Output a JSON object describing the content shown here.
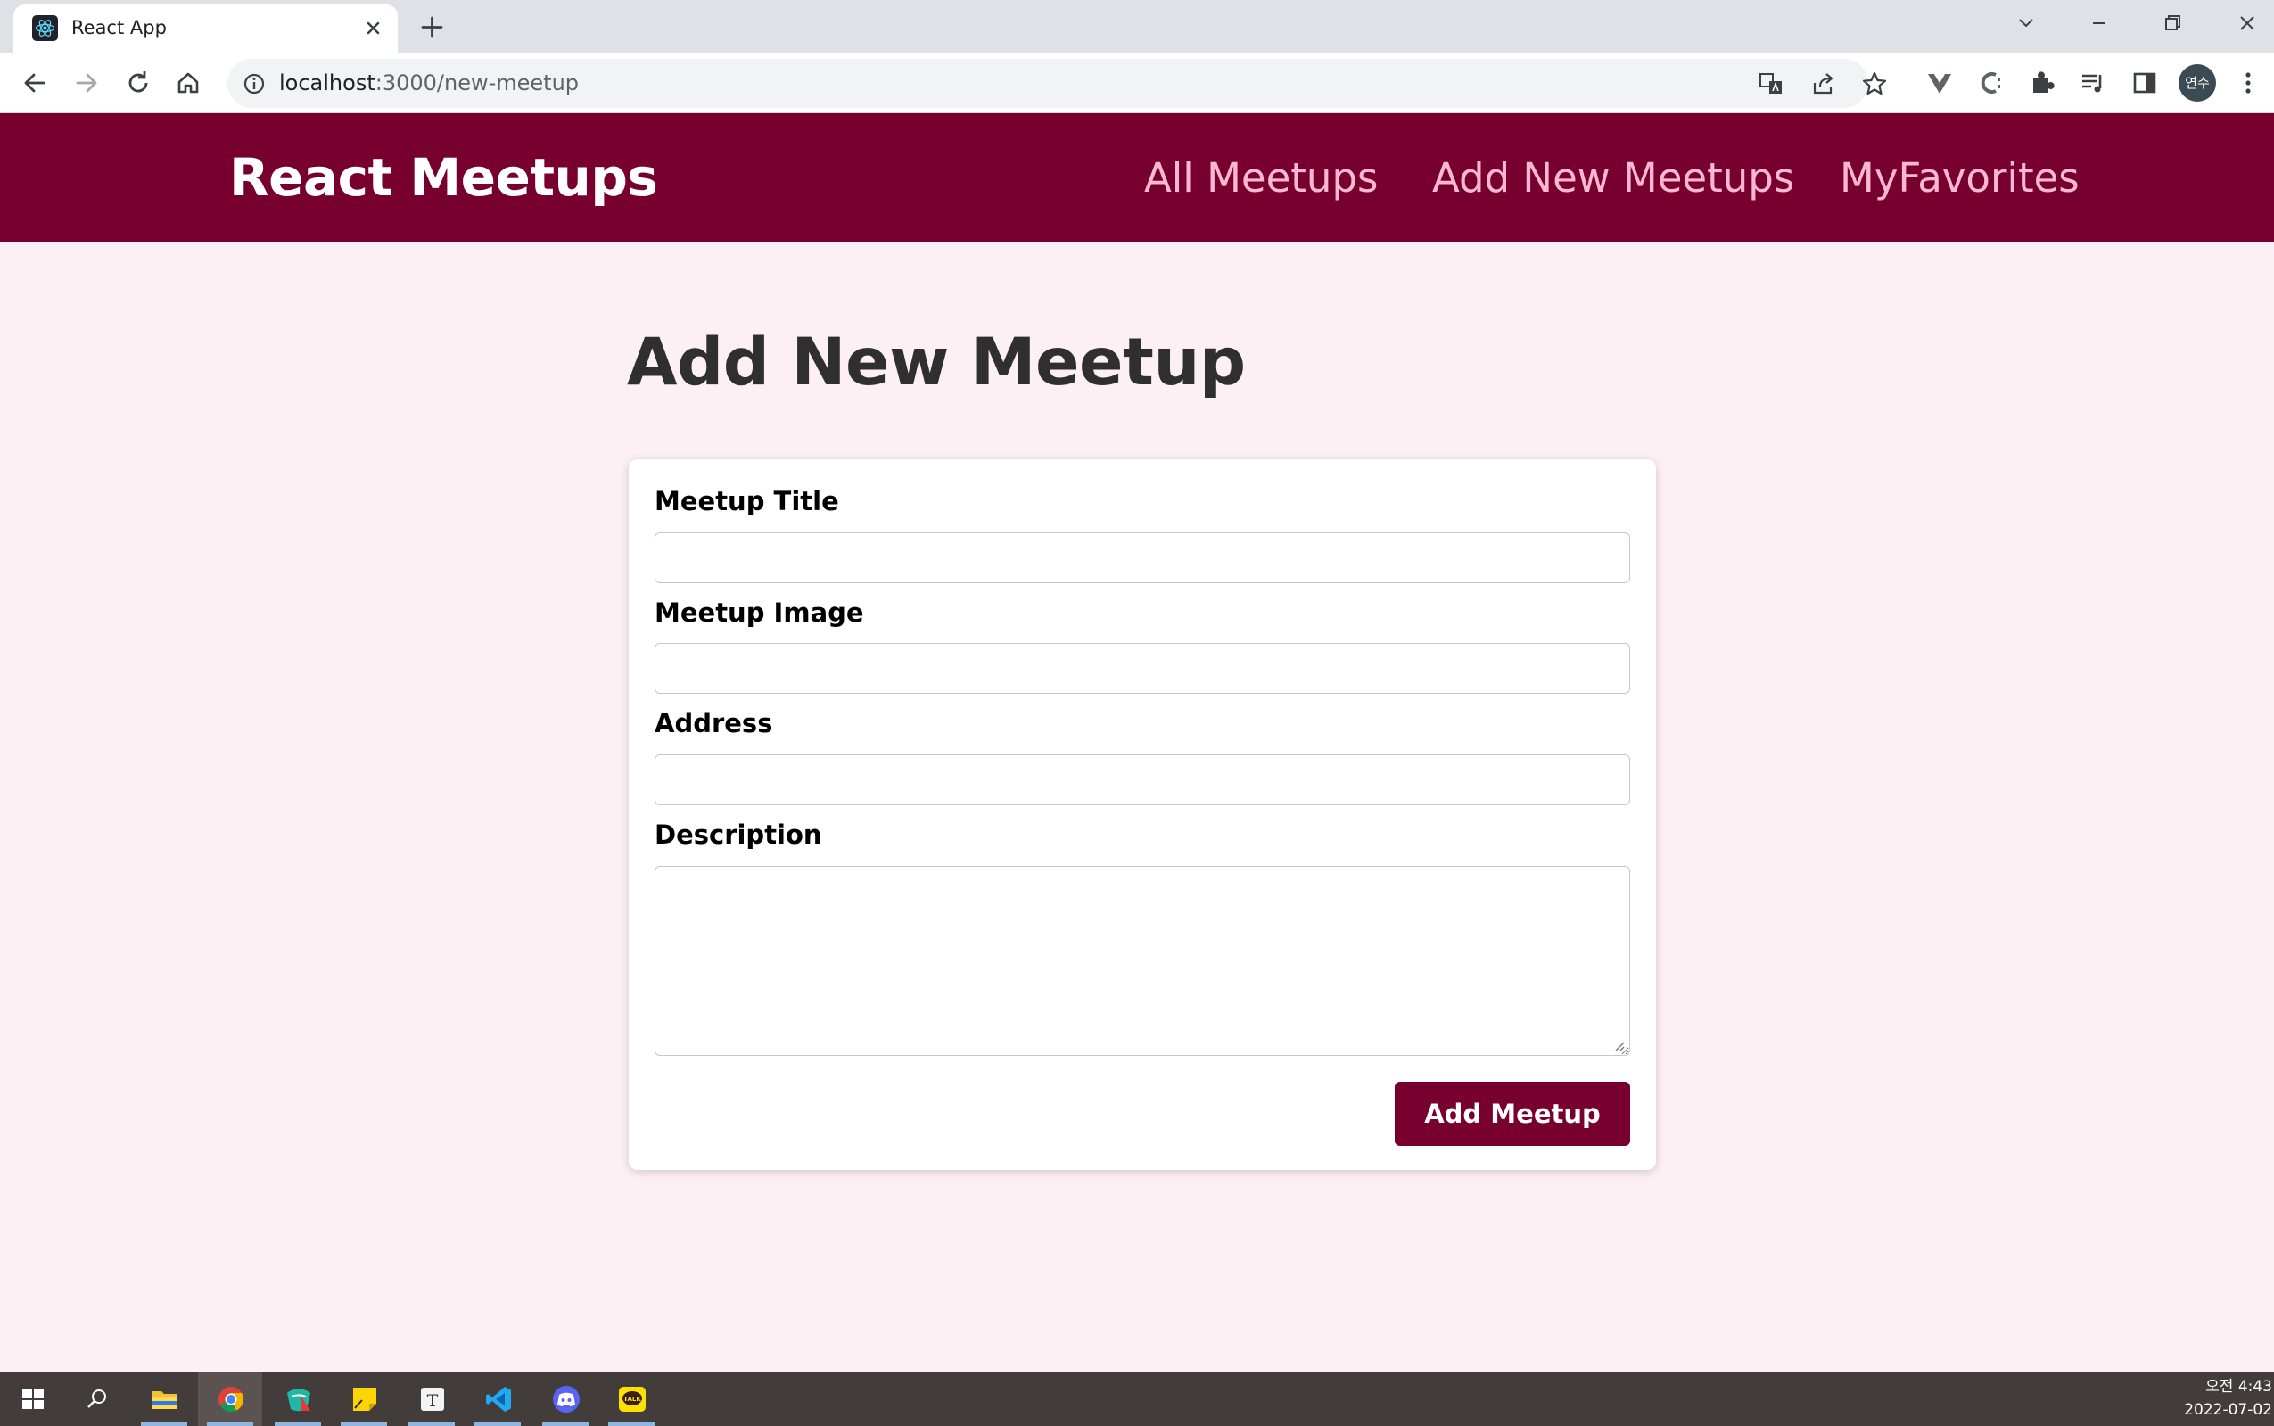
{
  "browser": {
    "tab_title": "React App",
    "url_host": "localhost",
    "url_path": ":3000/new-meetup",
    "profile_label": "연수"
  },
  "app": {
    "logo": "React Meetups",
    "nav": [
      {
        "label": "All Meetups"
      },
      {
        "label": "Add New Meetups"
      },
      {
        "label": "MyFavorites"
      }
    ]
  },
  "page": {
    "title": "Add New Meetup"
  },
  "form": {
    "title_label": "Meetup Title",
    "title_value": "",
    "image_label": "Meetup Image",
    "image_value": "",
    "address_label": "Address",
    "address_value": "",
    "description_label": "Description",
    "description_value": "",
    "submit_label": "Add Meetup"
  },
  "taskbar": {
    "time": "오전 4:43",
    "date": "2022-07-02",
    "apps": [
      "windows-start",
      "search",
      "file-explorer",
      "chrome",
      "app-green",
      "sticky-notes",
      "typora",
      "vscode",
      "discord",
      "kakaotalk"
    ]
  },
  "colors": {
    "brand": "#77002e",
    "nav_link": "#fcb8d2",
    "page_bg": "#fcf0f4"
  }
}
